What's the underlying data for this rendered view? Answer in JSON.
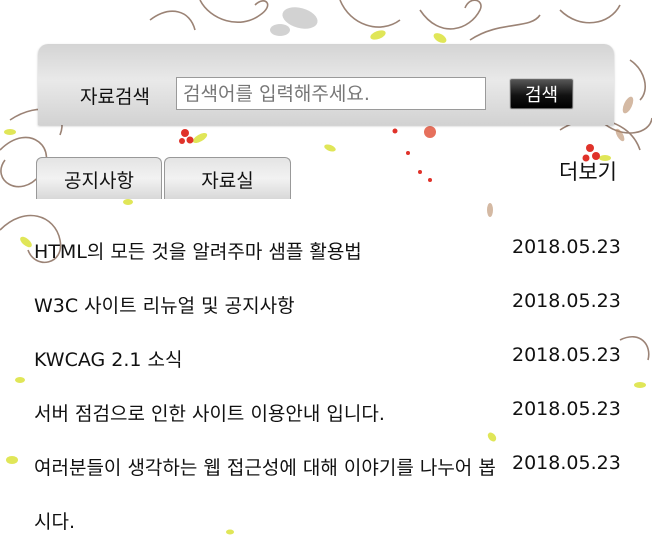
{
  "search": {
    "label": "자료검색",
    "placeholder": "검색어를 입력해주세요.",
    "value": "",
    "button_label": "검색"
  },
  "tabs": [
    {
      "label": "공지사항"
    },
    {
      "label": "자료실"
    }
  ],
  "more_label": "더보기",
  "notices": [
    {
      "title": "HTML의 모든 것을 알려주마 샘플 활용법",
      "date": "2018.05.23"
    },
    {
      "title": "W3C 사이트 리뉴얼 및 공지사항",
      "date": "2018.05.23"
    },
    {
      "title": "KWCAG 2.1 소식",
      "date": "2018.05.23"
    },
    {
      "title": "서버 점검으로 인한 사이트 이용안내 입니다.",
      "date": "2018.05.23"
    },
    {
      "title": "여러분들이 생각하는 웹 접근성에 대해 이야기를 나누어 봅시다.",
      "date": "2018.05.23"
    }
  ],
  "colors": {
    "panel": "#d9d9d9",
    "button": "#111111",
    "vine": "#7a5a48",
    "leaf": "#dbe23a",
    "berry": "#e0322a"
  },
  "decoration": [
    "floral-vine-background"
  ]
}
